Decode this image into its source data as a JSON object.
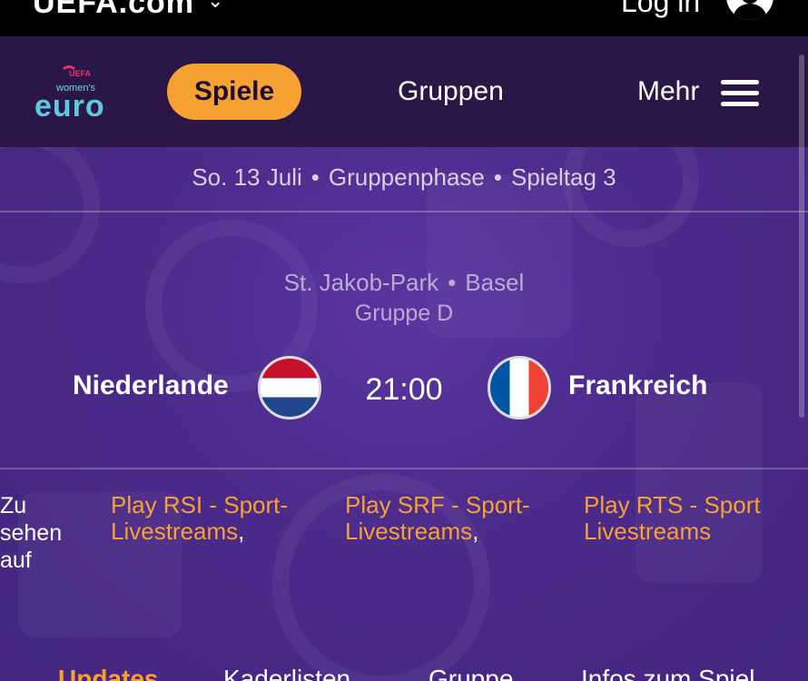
{
  "topbar": {
    "brand": "UEFA.com",
    "login": "Log in",
    "account_icon": "account-circle-icon"
  },
  "nav": {
    "logo_text_top": "UEFA",
    "logo_text_mid": "women's",
    "logo_text_main": "euro",
    "items": [
      {
        "label": "Spiele",
        "active": true
      },
      {
        "label": "Gruppen",
        "active": false
      },
      {
        "label": "Mehr",
        "active": false
      }
    ],
    "menu_icon": "hamburger-icon"
  },
  "match": {
    "date": "So. 13 Juli",
    "phase": "Gruppenphase",
    "matchday": "Spieltag 3",
    "stadium": "St. Jakob-Park",
    "city": "Basel",
    "group": "Gruppe D",
    "home_team": "Niederlande",
    "away_team": "Frankreich",
    "kickoff": "21:00",
    "home_flag": "netherlands-flag-icon",
    "away_flag": "france-flag-icon"
  },
  "broadcast": {
    "label": "Zu sehen auf",
    "streams": [
      {
        "line1": "Play RSI - Sport-",
        "line2": "Livestreams",
        "sep": ","
      },
      {
        "line1": "Play SRF - Sport-",
        "line2": "Livestreams",
        "sep": ","
      },
      {
        "line1": "Play RTS - Sport",
        "line2": "Livestreams",
        "sep": ""
      }
    ]
  },
  "tabs": [
    {
      "label": "Updates",
      "active": true
    },
    {
      "label": "Kaderlisten",
      "active": false
    },
    {
      "label": "Gruppe",
      "active": false
    },
    {
      "label": "Infos zum Spiel",
      "active": false
    }
  ],
  "colors": {
    "accent": "#f7a132",
    "nav_bg": "#2b1747",
    "page_bg": "#4a2a86"
  }
}
